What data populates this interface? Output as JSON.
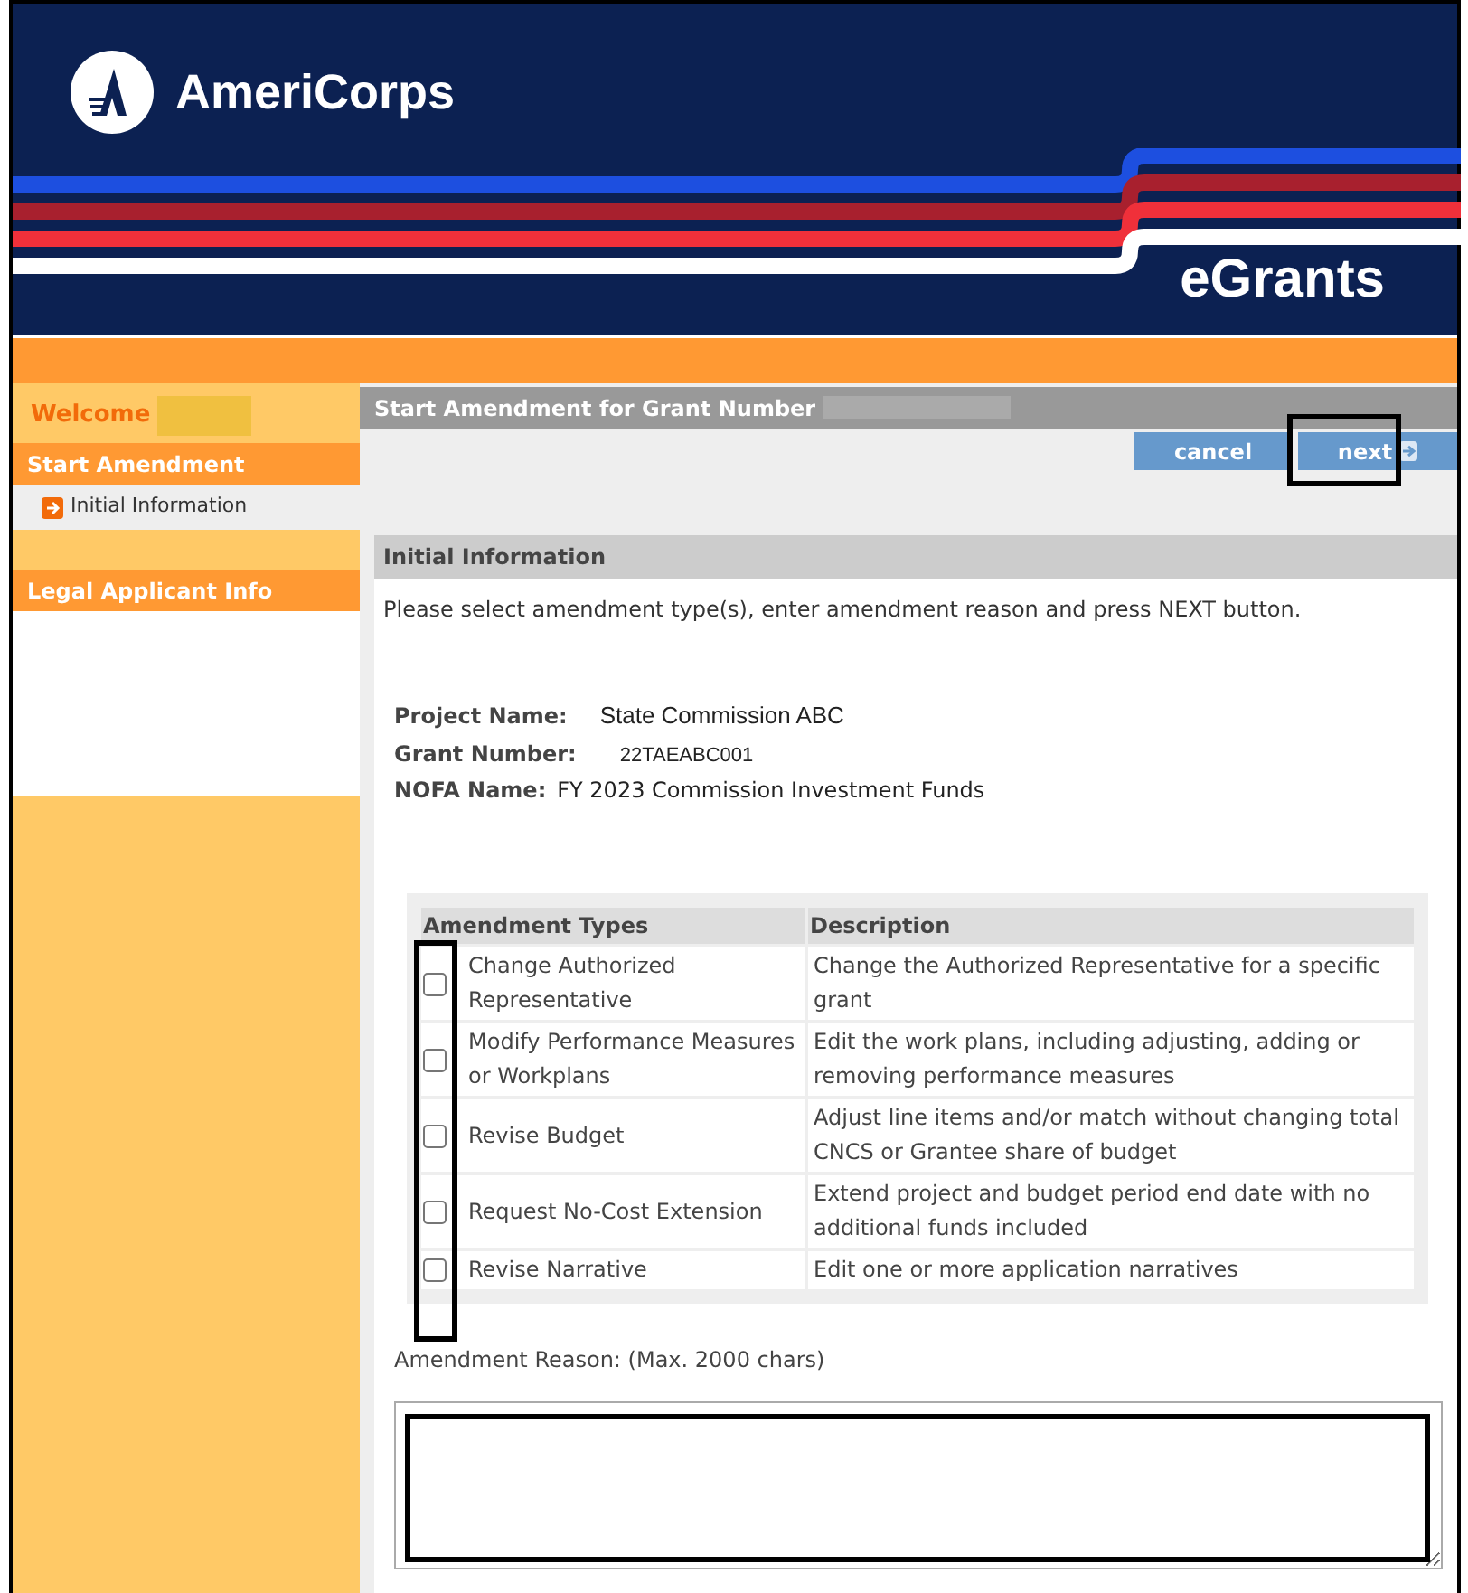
{
  "header": {
    "brand": "AmeriCorps",
    "product": "eGrants"
  },
  "sidebar": {
    "welcome": "Welcome",
    "sections": [
      {
        "label": "Start Amendment",
        "items": [
          {
            "label": "Initial Information",
            "selected": true
          }
        ]
      },
      {
        "label": "Legal Applicant Info"
      }
    ]
  },
  "page_title": "Start Amendment for Grant Number",
  "buttons": [
    {
      "label": "cancel",
      "kind": "plain"
    },
    {
      "label": "next",
      "kind": "arrow"
    }
  ],
  "section": {
    "title": "Initial Information",
    "instruction": "Please select amendment type(s), enter amendment reason and press NEXT button."
  },
  "details": [
    {
      "label": "Project Name:",
      "value": "State Commission ABC"
    },
    {
      "label": "Grant Number:",
      "value": "22TAEABC001"
    },
    {
      "label": "NOFA Name:",
      "value": "FY 2023 Commission Investment Funds"
    }
  ],
  "table": {
    "columns": [
      "Amendment Types",
      "Description"
    ],
    "rows": [
      {
        "type": "Change Authorized Representative",
        "description": "Change the Authorized Representative for a specific grant",
        "checked": false
      },
      {
        "type": "Modify Performance Measures or Workplans",
        "description": "Edit the work plans, including adjusting, adding or removing performance measures",
        "checked": false
      },
      {
        "type": "Revise Budget",
        "description": "Adjust line items and/or match without changing total CNCS or Grantee share of budget",
        "checked": false
      },
      {
        "type": "Request No-Cost Extension",
        "description": "Extend project and budget period end date with no additional funds included",
        "checked": false
      },
      {
        "type": "Revise Narrative",
        "description": "Edit one or more application narratives",
        "checked": false
      }
    ]
  },
  "reason": {
    "label": "Amendment Reason: (Max. 2000 chars)"
  }
}
